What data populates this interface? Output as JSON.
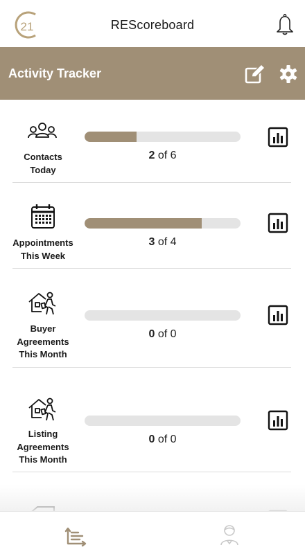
{
  "app": {
    "title": "REScoreboard",
    "logo_text": "21",
    "brand_color": "#a08f76"
  },
  "header": {
    "title": "Activity Tracker",
    "actions": [
      {
        "icon": "edit-icon"
      },
      {
        "icon": "gear-icon"
      }
    ]
  },
  "activities": [
    {
      "label_lines": [
        "Contacts",
        "Today"
      ],
      "current": "2",
      "sep": "of",
      "goal": "6",
      "progress": 0.333,
      "icon": "people-group-icon"
    },
    {
      "label_lines": [
        "Appointments",
        "This Week"
      ],
      "current": "3",
      "sep": "of",
      "goal": "4",
      "progress": 0.75,
      "icon": "calendar-icon"
    },
    {
      "label_lines": [
        "Buyer",
        "Agreements",
        "This Month"
      ],
      "current": "0",
      "sep": "of",
      "goal": "0",
      "progress": 0,
      "icon": "house-person-icon"
    },
    {
      "label_lines": [
        "Listing",
        "Agreements",
        "This Month"
      ],
      "current": "0",
      "sep": "of",
      "goal": "0",
      "progress": 0,
      "icon": "house-person-icon"
    }
  ],
  "bottom_nav": [
    {
      "icon": "activity-chart-icon",
      "active": true
    },
    {
      "icon": "profile-icon",
      "active": false
    }
  ]
}
